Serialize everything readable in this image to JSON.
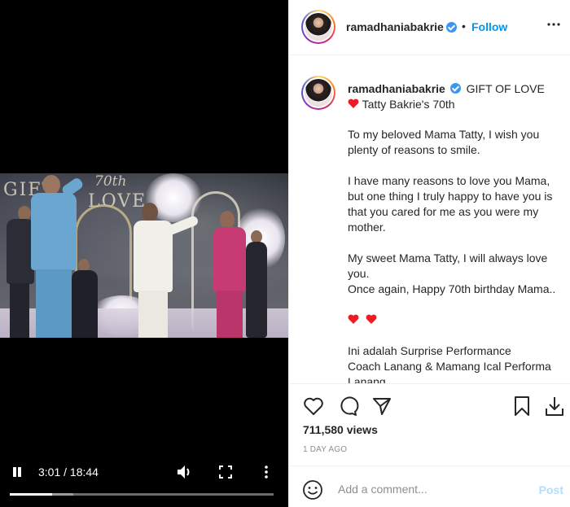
{
  "video": {
    "time_display": "3:01 / 18:44",
    "progress_fraction": 0.161,
    "buffer_fraction": 0.24,
    "overlay_text": [
      "GIFT",
      "70th",
      "LOVE"
    ],
    "icons": {
      "play_state": "pause-icon",
      "volume": "volume-icon",
      "fullscreen": "fullscreen-icon",
      "more": "more-vertical-icon"
    }
  },
  "header": {
    "username": "ramadhaniabakrie",
    "separator": "•",
    "follow_label": "Follow",
    "more_icon": "more-horizontal-icon"
  },
  "caption": {
    "username": "ramadhaniabakrie",
    "title": "GIFT OF LOVE",
    "subtitle": "Tatty Bakrie's 70th",
    "paragraphs": [
      "To my beloved Mama Tatty, I wish you plenty of reasons to smile.",
      "I have many reasons to love you Mama, but one thing I truly happy to have you is that you cared for me as you were my mother.",
      "My sweet Mama Tatty, I will always love you.",
      "Once again, Happy 70th birthday Mama..",
      "Ini adalah Surprise Performance",
      "Coach Lanang & Mamang Ical Performa Lanang"
    ]
  },
  "actions": {
    "like_icon": "heart-icon",
    "comment_icon": "comment-icon",
    "share_icon": "share-icon",
    "save_icon": "bookmark-icon",
    "download_icon": "download-icon"
  },
  "stats": {
    "views": "711,580 views",
    "posted": "1 DAY AGO"
  },
  "comment_box": {
    "placeholder": "Add a comment...",
    "post_label": "Post",
    "emoji_icon": "emoji-icon"
  },
  "colors": {
    "link_blue": "#0095f6",
    "verified_blue": "#3897f0",
    "heart_red": "#ed1c24",
    "post_disabled": "#b2dffc",
    "muted": "#8e8e8e"
  }
}
